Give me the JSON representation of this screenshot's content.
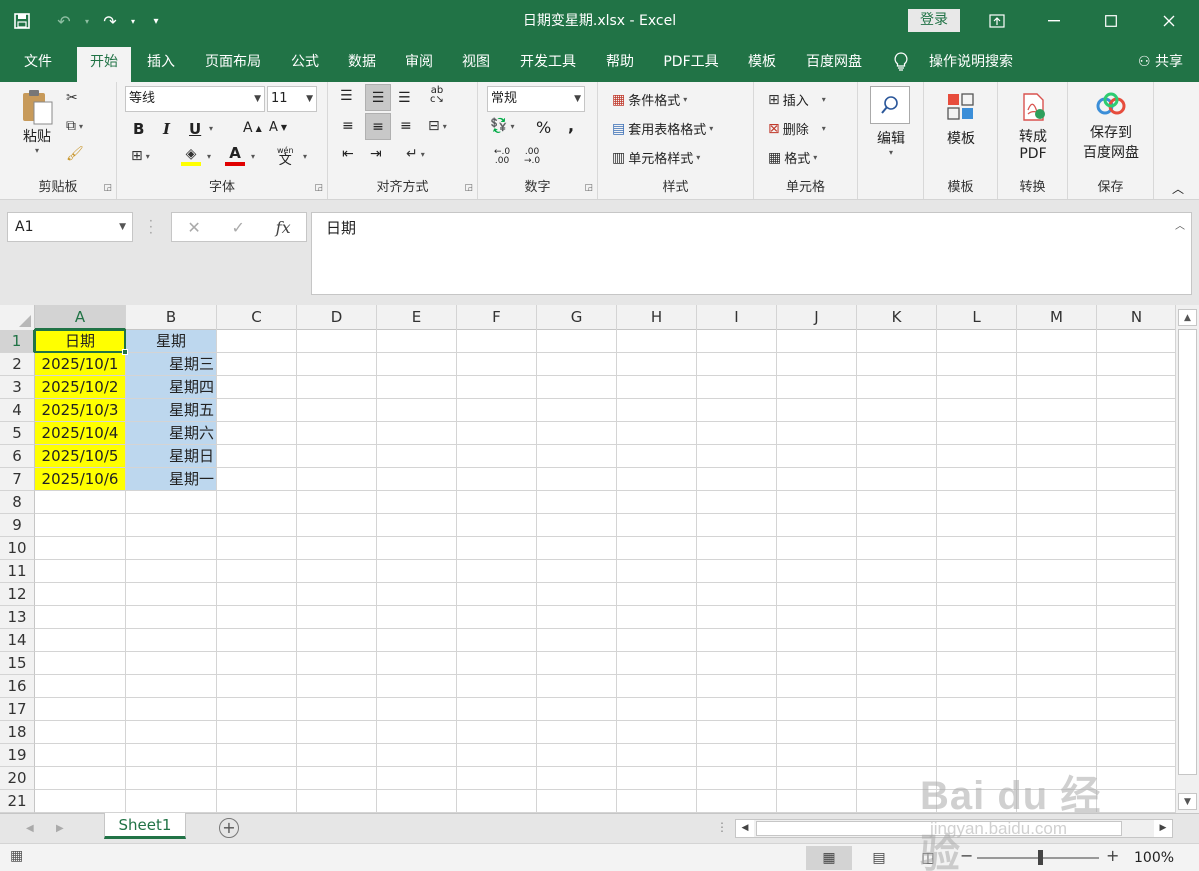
{
  "window": {
    "title": "日期变星期.xlsx - Excel",
    "login": "登录",
    "controls": [
      "restore-ribbon",
      "minimize",
      "maximize",
      "close"
    ]
  },
  "qat": {
    "save": "save-icon",
    "undo": "undo-icon",
    "redo": "redo-icon",
    "customize": "customize-icon"
  },
  "tabs": [
    "文件",
    "开始",
    "插入",
    "页面布局",
    "公式",
    "数据",
    "审阅",
    "视图",
    "开发工具",
    "帮助",
    "PDF工具",
    "模板",
    "百度网盘"
  ],
  "active_tab": "开始",
  "tell_me": "操作说明搜索",
  "share": "共享",
  "ribbon": {
    "clipboard": {
      "label": "剪贴板",
      "paste": "粘贴"
    },
    "font": {
      "label": "字体",
      "font_name": "等线",
      "font_size": "11",
      "bold": "B",
      "italic": "I",
      "underline": "U",
      "phonetic": "wén"
    },
    "alignment": {
      "label": "对齐方式"
    },
    "number": {
      "label": "数字",
      "format": "常规",
      "percent": "%",
      "comma": ","
    },
    "styles": {
      "label": "样式",
      "conditional": "条件格式",
      "table": "套用表格格式",
      "cell_styles": "单元格样式"
    },
    "cells": {
      "label": "单元格",
      "insert": "插入",
      "delete": "删除",
      "format": "格式"
    },
    "editing": {
      "label": "编辑"
    },
    "template": {
      "label": "模板",
      "button": "模板"
    },
    "convert": {
      "label": "转换",
      "button_line1": "转成",
      "button_line2": "PDF"
    },
    "save": {
      "label": "保存",
      "button_line1": "保存到",
      "button_line2": "百度网盘"
    }
  },
  "formula_bar": {
    "name_box": "A1",
    "fx": "fx",
    "content": "日期"
  },
  "sheet": {
    "columns": [
      "A",
      "B",
      "C",
      "D",
      "E",
      "F",
      "G",
      "H",
      "I",
      "J",
      "K",
      "L",
      "M",
      "N"
    ],
    "rows": [
      "1",
      "2",
      "3",
      "4",
      "5",
      "6",
      "7",
      "8",
      "9",
      "10",
      "11",
      "12",
      "13",
      "14",
      "15",
      "16",
      "17",
      "18",
      "19",
      "20",
      "21"
    ],
    "selected_cell": "A1",
    "fill_colors": {
      "A": "#ffff00",
      "B": "#bdd7ee"
    },
    "data": [
      [
        "日期",
        "星期"
      ],
      [
        "2025/10/1",
        "星期三"
      ],
      [
        "2025/10/2",
        "星期四"
      ],
      [
        "2025/10/3",
        "星期五"
      ],
      [
        "2025/10/4",
        "星期六"
      ],
      [
        "2025/10/5",
        "星期日"
      ],
      [
        "2025/10/6",
        "星期一"
      ]
    ]
  },
  "sheet_tabs": [
    "Sheet1"
  ],
  "status": {
    "zoom": "100%",
    "minus": "−",
    "plus": "+"
  },
  "watermark": {
    "main": "Bai du 经验",
    "sub": "jingyan.baidu.com"
  },
  "colors": {
    "accent": "#217346"
  }
}
